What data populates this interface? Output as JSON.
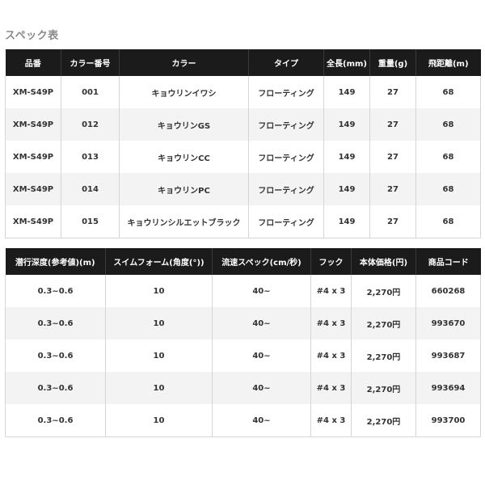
{
  "title": "スペック表",
  "table1": {
    "headers": [
      "品番",
      "カラー番号",
      "カラー",
      "タイプ",
      "全長(mm)",
      "重量(g)",
      "飛距離(m)"
    ],
    "rows": [
      [
        "XM-S49P",
        "001",
        "キョウリンイワシ",
        "フローティング",
        "149",
        "27",
        "68"
      ],
      [
        "XM-S49P",
        "012",
        "キョウリンGS",
        "フローティング",
        "149",
        "27",
        "68"
      ],
      [
        "XM-S49P",
        "013",
        "キョウリンCC",
        "フローティング",
        "149",
        "27",
        "68"
      ],
      [
        "XM-S49P",
        "014",
        "キョウリンPC",
        "フローティング",
        "149",
        "27",
        "68"
      ],
      [
        "XM-S49P",
        "015",
        "キョウリンシルエットブラック",
        "フローティング",
        "149",
        "27",
        "68"
      ]
    ]
  },
  "table2": {
    "headers": [
      "潜行深度(参考値)(m)",
      "スイムフォーム(角度(°))",
      "流速スペック(cm/秒)",
      "フック",
      "本体価格(円)",
      "商品コード"
    ],
    "rows": [
      [
        "0.3~0.6",
        "10",
        "40~",
        "#4 x 3",
        "2,270円",
        "660268"
      ],
      [
        "0.3~0.6",
        "10",
        "40~",
        "#4 x 3",
        "2,270円",
        "993670"
      ],
      [
        "0.3~0.6",
        "10",
        "40~",
        "#4 x 3",
        "2,270円",
        "993687"
      ],
      [
        "0.3~0.6",
        "10",
        "40~",
        "#4 x 3",
        "2,270円",
        "993694"
      ],
      [
        "0.3~0.6",
        "10",
        "40~",
        "#4 x 3",
        "2,270円",
        "993700"
      ]
    ]
  }
}
